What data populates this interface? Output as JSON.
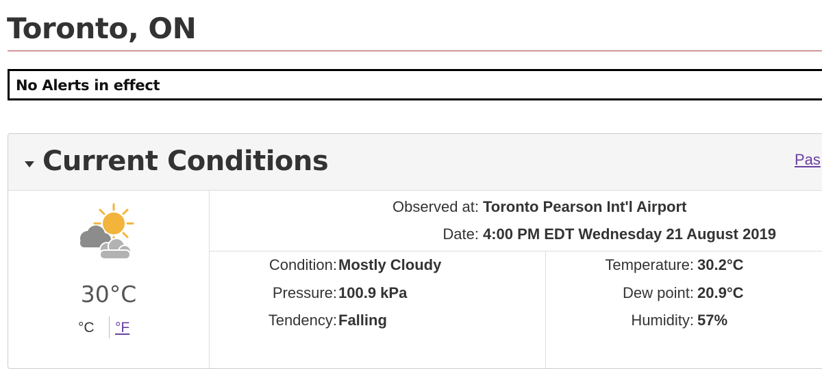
{
  "page": {
    "title": "Toronto, ON",
    "alert_text": "No Alerts in effect"
  },
  "colors": {
    "title_rule": "#af3c43",
    "link": "#6a3ea1",
    "panel_heading_bg": "#f5f5f5",
    "sun": "#f2b43b",
    "cloud": "#8c8c8c"
  },
  "current_conditions": {
    "heading": "Current Conditions",
    "past_link_label": "Pas",
    "icon": "sun-behind-clouds-icon",
    "temperature_display": "30°C",
    "unit_celsius_label": "°C",
    "unit_fahrenheit_label": "°F",
    "observed_at_label": "Observed at:",
    "observed_at_value": "Toronto Pearson Int'l Airport",
    "date_label": "Date:",
    "date_value": "4:00 PM EDT Wednesday 21 August 2019",
    "left_details": [
      {
        "label": "Condition:",
        "value": "Mostly Cloudy"
      },
      {
        "label": "Pressure:",
        "value": "100.9 kPa"
      },
      {
        "label": "Tendency:",
        "value": "Falling"
      }
    ],
    "right_details": [
      {
        "label": "Temperature:",
        "value": "30.2°C"
      },
      {
        "label": "Dew point:",
        "value": "20.9°C"
      },
      {
        "label": "Humidity:",
        "value": "57%"
      }
    ]
  }
}
